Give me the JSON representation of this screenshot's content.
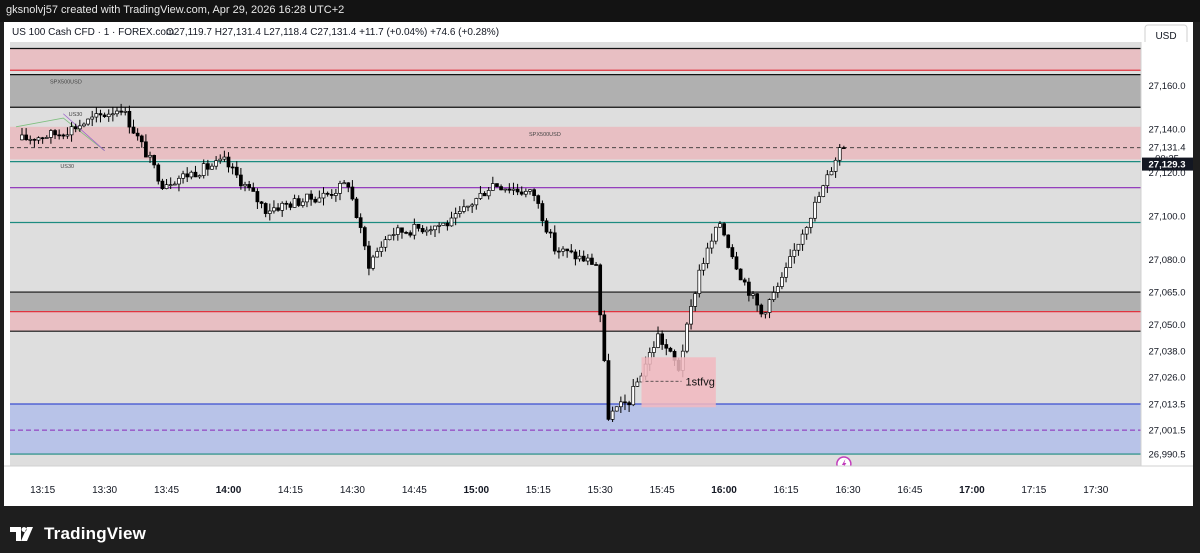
{
  "header": {
    "created_text": "gksnolvj57 created with TradingView.com, Apr 29, 2026 16:28 UTC+2"
  },
  "legend": {
    "symbol_text": "US 100 Cash CFD · 1 · FOREX.com",
    "ohlc_text": "O27,119.7 H27,131.4 L27,118.4 C27,131.4 +11.7 (+0.04%) +74.6 (+0.28%)"
  },
  "currency_button": "USD",
  "brand": {
    "name": "TradingView"
  },
  "colors": {
    "up": "#ffffff",
    "down": "#000000",
    "wick": "#000000",
    "plot_bg": "#dedede",
    "red_zone": "#e8bfc3",
    "gray_zone": "#b0b0b0",
    "blue_zone": "#b8c3e8",
    "teal": "#1c8b80",
    "purple": "#8a28b8",
    "red_line": "#e0343f",
    "blue_line": "#3b4fd0"
  },
  "chart_data": {
    "type": "candlestick",
    "symbol": "US 100 Cash CFD",
    "interval": "1",
    "ylim": [
      26985,
      27180
    ],
    "y_ticks": [
      "27,160.0",
      "27,140.0",
      "27,120.0",
      "27,100.0",
      "27,080.0",
      "27,065.0",
      "27,050.0",
      "27,038.0",
      "27,026.0",
      "27,013.5",
      "27,001.5",
      "26,990.5"
    ],
    "x_ticks": [
      {
        "label": "13:15",
        "bold": false
      },
      {
        "label": "13:30",
        "bold": false
      },
      {
        "label": "13:45",
        "bold": false
      },
      {
        "label": "14:00",
        "bold": true
      },
      {
        "label": "14:15",
        "bold": false
      },
      {
        "label": "14:30",
        "bold": false
      },
      {
        "label": "14:45",
        "bold": false
      },
      {
        "label": "15:00",
        "bold": true
      },
      {
        "label": "15:15",
        "bold": false
      },
      {
        "label": "15:30",
        "bold": false
      },
      {
        "label": "15:45",
        "bold": false
      },
      {
        "label": "16:00",
        "bold": true
      },
      {
        "label": "16:15",
        "bold": false
      },
      {
        "label": "16:30",
        "bold": false
      },
      {
        "label": "16:45",
        "bold": false
      },
      {
        "label": "17:00",
        "bold": true
      },
      {
        "label": "17:15",
        "bold": false
      },
      {
        "label": "17:30",
        "bold": false
      }
    ],
    "x_start_time": "13:10",
    "price_labels": [
      {
        "text": "27,131.4",
        "type": "last"
      },
      {
        "text": "00:25",
        "type": "countdown"
      },
      {
        "text": "27,129.3",
        "type": "highlight"
      }
    ],
    "zones": [
      {
        "top": 27177,
        "bottom": 27167,
        "kind": "red"
      },
      {
        "top": 27165,
        "bottom": 27150,
        "kind": "gray",
        "label": "SPX500USD"
      },
      {
        "top": 27141,
        "bottom": 27126,
        "kind": "red",
        "label": "SPX500USD"
      },
      {
        "top": 27065,
        "bottom": 27056,
        "kind": "gray"
      },
      {
        "top": 27056,
        "bottom": 27047,
        "kind": "red"
      },
      {
        "top": 27013.5,
        "bottom": 26990.5,
        "kind": "blue"
      }
    ],
    "fvg_box": {
      "from": "15:40",
      "to": "15:58",
      "top": 27035,
      "bottom": 27012,
      "label": "1stfvg"
    },
    "hlines": [
      {
        "price": 27177,
        "color": "black"
      },
      {
        "price": 27167,
        "color": "red"
      },
      {
        "price": 27165,
        "color": "black"
      },
      {
        "price": 27150,
        "color": "black"
      },
      {
        "price": 27131.4,
        "color": "dashed"
      },
      {
        "price": 27125,
        "color": "teal"
      },
      {
        "price": 27113,
        "color": "purple"
      },
      {
        "price": 27097,
        "color": "teal"
      },
      {
        "price": 27065,
        "color": "black"
      },
      {
        "price": 27056,
        "color": "red"
      },
      {
        "price": 27047,
        "color": "black"
      },
      {
        "price": 27013.5,
        "color": "blue"
      },
      {
        "price": 27001.5,
        "color": "purple-dashed"
      },
      {
        "price": 26990.5,
        "color": "teal"
      }
    ],
    "annotations": [
      {
        "text": "US30",
        "time": "13:30",
        "price": 27146
      },
      {
        "text": "US30",
        "time": "13:28",
        "price": 27122
      }
    ],
    "key_points": [
      {
        "time": "13:10",
        "price": 27135
      },
      {
        "time": "13:20",
        "price": 27138
      },
      {
        "time": "13:35",
        "price": 27150
      },
      {
        "time": "13:45",
        "price": 27115
      },
      {
        "time": "14:00",
        "price": 27125
      },
      {
        "time": "14:10",
        "price": 27103
      },
      {
        "time": "14:25",
        "price": 27110
      },
      {
        "time": "14:30",
        "price": 27115
      },
      {
        "time": "14:35",
        "price": 27078
      },
      {
        "time": "14:40",
        "price": 27092
      },
      {
        "time": "14:55",
        "price": 27097
      },
      {
        "time": "15:05",
        "price": 27115
      },
      {
        "time": "15:15",
        "price": 27110
      },
      {
        "time": "15:20",
        "price": 27085
      },
      {
        "time": "15:30",
        "price": 27078
      },
      {
        "time": "15:33",
        "price": 27008
      },
      {
        "time": "15:38",
        "price": 27015
      },
      {
        "time": "15:45",
        "price": 27045
      },
      {
        "time": "15:50",
        "price": 27030
      },
      {
        "time": "15:55",
        "price": 27075
      },
      {
        "time": "16:00",
        "price": 27097
      },
      {
        "time": "16:05",
        "price": 27073
      },
      {
        "time": "16:10",
        "price": 27055
      },
      {
        "time": "16:15",
        "price": 27070
      },
      {
        "time": "16:20",
        "price": 27093
      },
      {
        "time": "16:25",
        "price": 27113
      },
      {
        "time": "16:29",
        "price": 27131.4
      }
    ]
  }
}
